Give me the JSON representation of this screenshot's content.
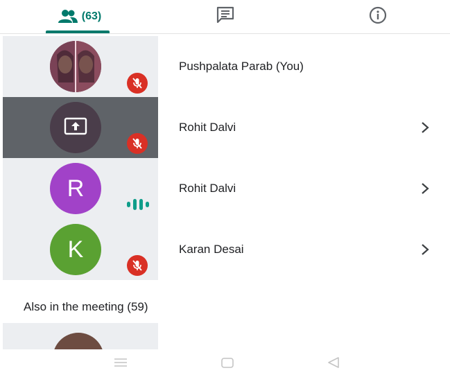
{
  "tabs": {
    "people": {
      "icon": "people-icon",
      "count_label": "(63)"
    },
    "chat": {
      "icon": "chat-icon"
    },
    "info": {
      "icon": "info-icon"
    }
  },
  "participants": [
    {
      "name": "Pushpalata Parab (You)",
      "avatar": "photo",
      "mic": "muted",
      "chevron": false
    },
    {
      "name": "Rohit Dalvi",
      "avatar": "present-screen-icon",
      "mic": "muted",
      "chevron": true,
      "presenting": true
    },
    {
      "name": "Rohit Dalvi",
      "avatar_initial": "R",
      "avatar_color": "#a142c8",
      "mic": "speaking",
      "chevron": true
    },
    {
      "name": "Karan Desai",
      "avatar_initial": "K",
      "avatar_color": "#5aa132",
      "mic": "muted",
      "chevron": true
    }
  ],
  "also_in_meeting": {
    "title": "Also in the meeting (59)"
  },
  "colors": {
    "accent": "#00796b",
    "muted": "#d93025",
    "speaking": "#0f9d8a"
  },
  "system_nav": [
    "menu-icon",
    "home-icon",
    "back-icon"
  ]
}
